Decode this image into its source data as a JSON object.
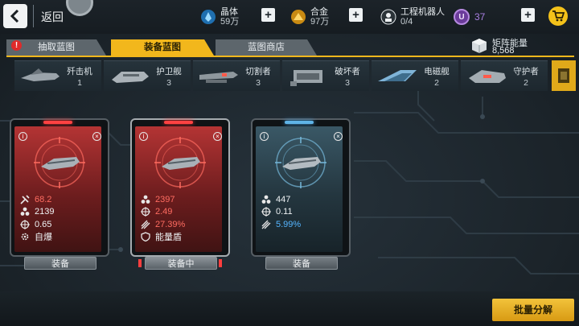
{
  "header": {
    "back_label": "返回",
    "resources": [
      {
        "icon": "crystal-icon",
        "label": "晶体",
        "value": "59万"
      },
      {
        "icon": "alloy-icon",
        "label": "合金",
        "value": "97万"
      },
      {
        "icon": "robot-icon",
        "label": "工程机器人",
        "value": "0/4"
      }
    ],
    "premium": {
      "icon_letter": "U",
      "value": "37"
    }
  },
  "tabs": [
    {
      "label": "抽取蓝图",
      "active": false,
      "alert": "!"
    },
    {
      "label": "装备蓝图",
      "active": true
    },
    {
      "label": "蓝图商店",
      "active": false
    }
  ],
  "matrix_energy": {
    "label": "矩阵能量",
    "value": "8,568"
  },
  "ship_types": [
    {
      "name": "歼击机",
      "count": "1"
    },
    {
      "name": "护卫舰",
      "count": "3"
    },
    {
      "name": "切割者",
      "count": "3"
    },
    {
      "name": "破坏者",
      "count": "3"
    },
    {
      "name": "电磁舰",
      "count": "2"
    },
    {
      "name": "守护者",
      "count": "2"
    }
  ],
  "cards": [
    {
      "theme": "red",
      "stats": [
        {
          "icon": "damage-icon",
          "value": "68.2",
          "color": "red"
        },
        {
          "icon": "hull-icon",
          "value": "2139",
          "color": "white"
        },
        {
          "icon": "crosshair-icon",
          "value": "0.65",
          "color": "white"
        },
        {
          "icon": "gear-icon",
          "value": "自爆",
          "color": "white"
        }
      ],
      "button": "装备"
    },
    {
      "theme": "red",
      "selected": true,
      "stats": [
        {
          "icon": "hull-icon",
          "value": "2397",
          "color": "red"
        },
        {
          "icon": "crosshair-icon",
          "value": "2.49",
          "color": "red"
        },
        {
          "icon": "missile-icon",
          "value": "27.39%",
          "color": "red"
        },
        {
          "icon": "shield-icon",
          "value": "能量盾",
          "color": "white"
        }
      ],
      "button": "装备中"
    },
    {
      "theme": "blue",
      "stats": [
        {
          "icon": "hull-icon",
          "value": "447",
          "color": "white"
        },
        {
          "icon": "crosshair-icon",
          "value": "0.11",
          "color": "white"
        },
        {
          "icon": "missile-icon",
          "value": "5.99%",
          "color": "blue"
        }
      ],
      "button": "装备"
    }
  ],
  "batch_button": "批量分解",
  "colors": {
    "accent": "#f2b71c",
    "red": "#ff6c61",
    "blue": "#55b5ff"
  }
}
